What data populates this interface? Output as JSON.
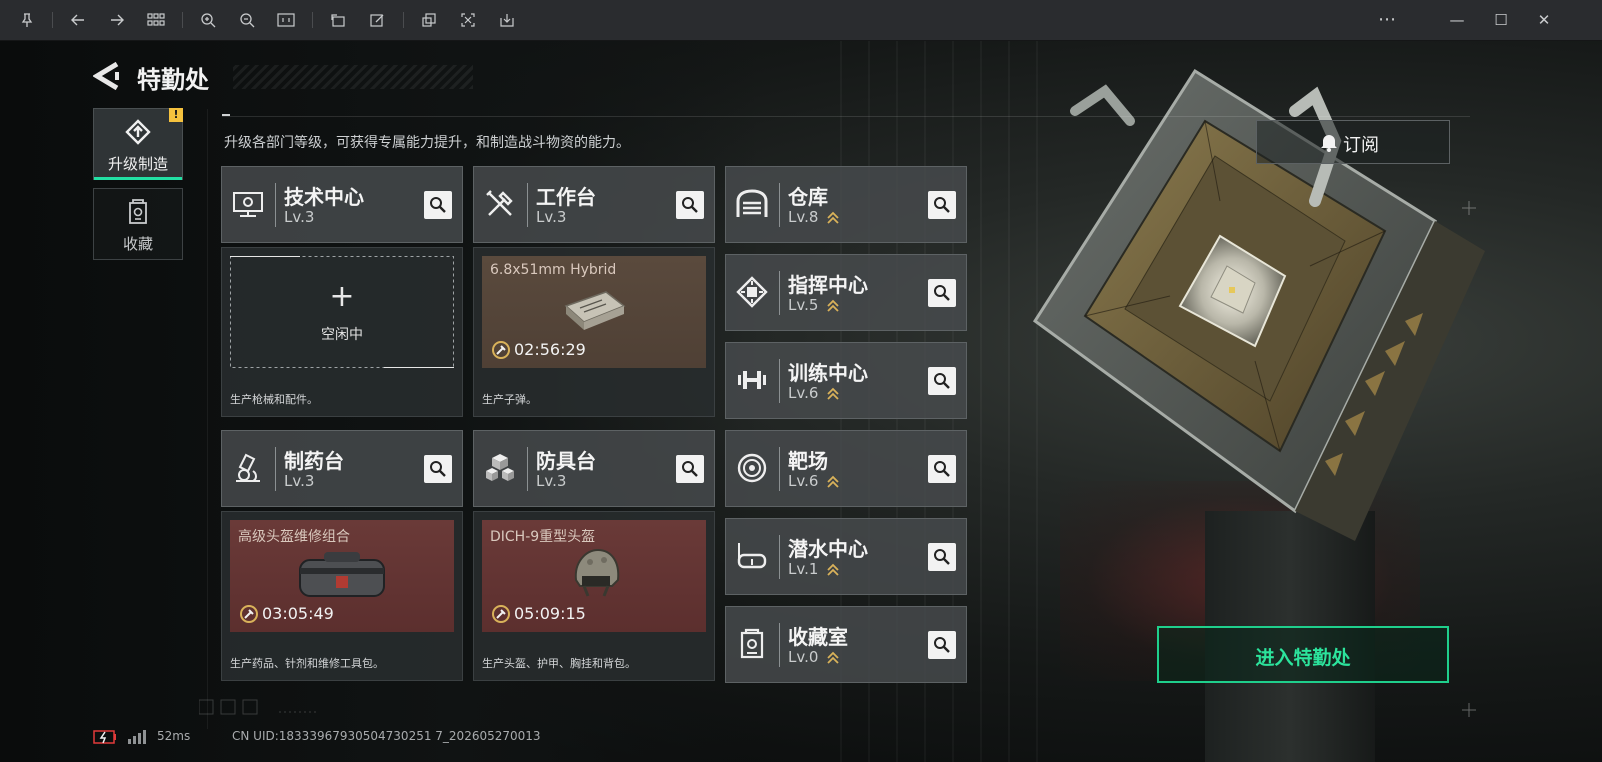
{
  "app": {
    "window_controls": {
      "more": "⋯",
      "minimize": "—",
      "maximize": "☐",
      "close": "✕"
    }
  },
  "header": {
    "title": "特勤处"
  },
  "sidebar": {
    "tabs": [
      {
        "label": "升级制造",
        "active": true,
        "alert": "!"
      },
      {
        "label": "收藏",
        "active": false
      }
    ]
  },
  "main": {
    "description": "升级各部门等级，可获得专属能力提升，和制造战斗物资的能力。",
    "production_cards": [
      {
        "name": "技术中心",
        "level": "Lv.3",
        "status": "idle",
        "idle_label": "空闲中",
        "plus": "+",
        "caption": "生产枪械和配件。"
      },
      {
        "name": "工作台",
        "level": "Lv.3",
        "status": "producing",
        "item": "6.8x51mm Hybrid",
        "timer": "02:56:29",
        "caption": "生产子弹。"
      },
      {
        "name": "制药台",
        "level": "Lv.3",
        "status": "producing",
        "item": "高级头盔维修组合",
        "timer": "03:05:49",
        "caption": "生产药品、针剂和维修工具包。"
      },
      {
        "name": "防具台",
        "level": "Lv.3",
        "status": "producing",
        "item": "DICH-9重型头盔",
        "timer": "05:09:15",
        "caption": "生产头盔、护甲、胸挂和背包。"
      }
    ],
    "facility_cards": [
      {
        "name": "仓库",
        "level": "Lv.8",
        "upgradable": true
      },
      {
        "name": "指挥中心",
        "level": "Lv.5",
        "upgradable": true
      },
      {
        "name": "训练中心",
        "level": "Lv.6",
        "upgradable": true
      },
      {
        "name": "靶场",
        "level": "Lv.6",
        "upgradable": true
      },
      {
        "name": "潜水中心",
        "level": "Lv.1",
        "upgradable": true
      },
      {
        "name": "收藏室",
        "level": "Lv.0",
        "upgradable": true
      }
    ]
  },
  "actions": {
    "subscribe": "订阅",
    "enter": "进入特勤处"
  },
  "status_bar": {
    "latency": "52ms",
    "uid": "CN UID:18333967930504730251 7_202605270013"
  },
  "colors": {
    "accent_green": "#22e0a4",
    "alert_yellow": "#f5c23e",
    "upgrade_gold": "#d9b25a"
  }
}
